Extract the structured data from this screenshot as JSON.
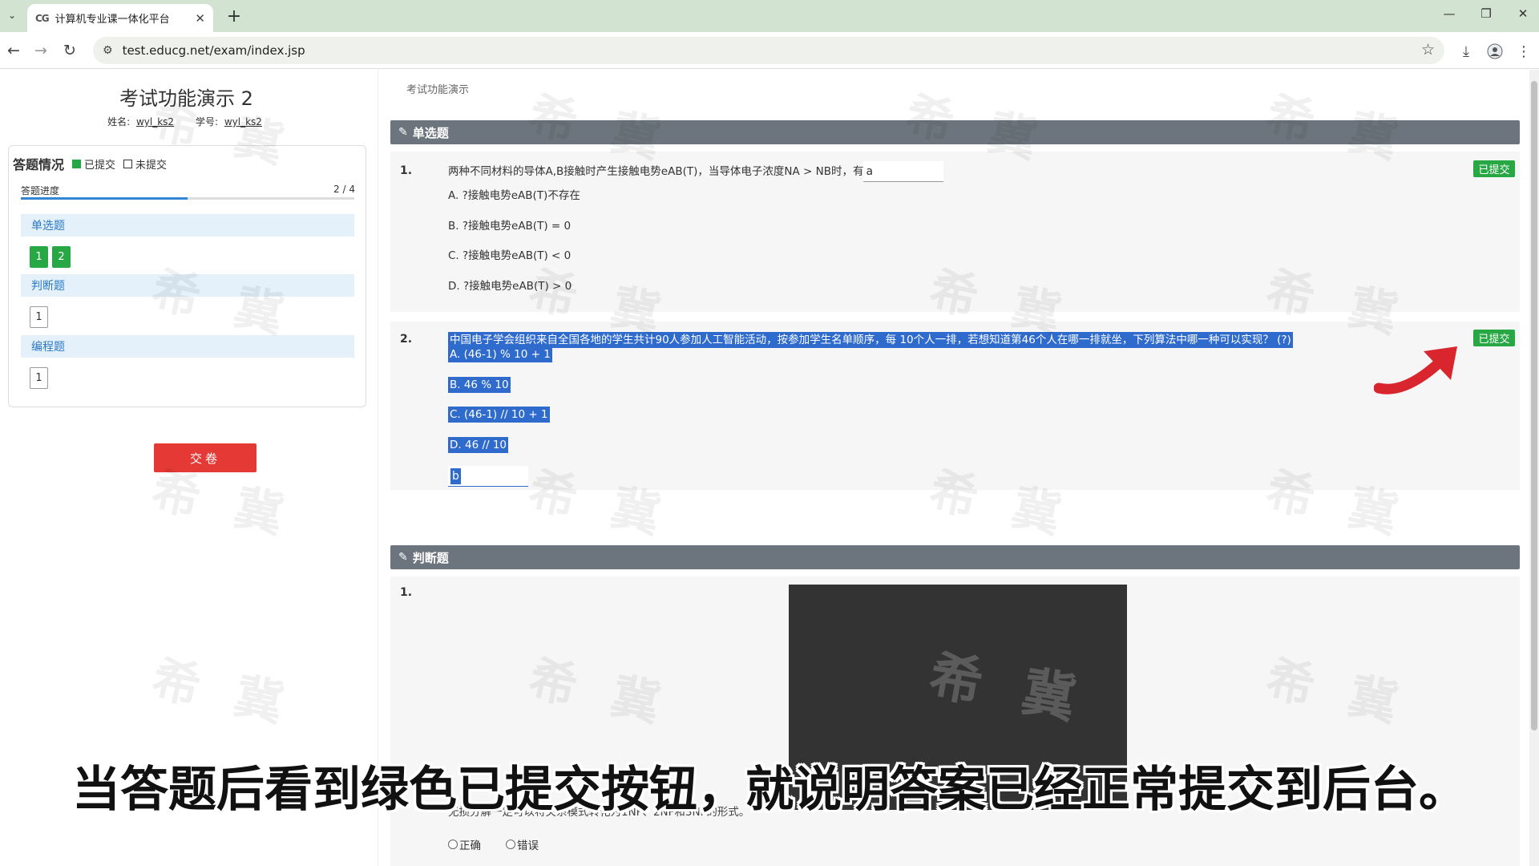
{
  "browser": {
    "tab_favicon": "CG",
    "tab_title": "计算机专业课一体化平台",
    "url": "test.educg.net/exam/index.jsp"
  },
  "sidebar": {
    "exam_title": "考试功能演示 2",
    "name_label": "姓名:",
    "name_value": "wyl_ks2",
    "id_label": "学号:",
    "id_value": "wyl_ks2",
    "status_title": "答题情况",
    "legend_submitted": "已提交",
    "legend_unsubmitted": "未提交",
    "progress_label": "答题进度",
    "progress_count": "2 / 4",
    "progress_fraction": 0.5,
    "sections": [
      {
        "label": "单选题",
        "questions": [
          {
            "num": "1",
            "submitted": true
          },
          {
            "num": "2",
            "submitted": true
          }
        ]
      },
      {
        "label": "判断题",
        "questions": [
          {
            "num": "1",
            "submitted": false
          }
        ]
      },
      {
        "label": "编程题",
        "questions": [
          {
            "num": "1",
            "submitted": false
          }
        ]
      }
    ],
    "submit_label": "交卷"
  },
  "main": {
    "breadcrumb": "考试功能演示",
    "single_choice": {
      "header": "单选题",
      "q1": {
        "num": "1.",
        "text": "两种不同材料的导体A,B接触时产生接触电势eAB(T)，当导体电子浓度NA > NB时，有",
        "answer": "a",
        "options": [
          "A. ?接触电势eAB(T)不存在",
          "B. ?接触电势eAB(T) = 0",
          "C. ?接触电势eAB(T) < 0",
          "D. ?接触电势eAB(T) > 0"
        ],
        "badge": "已提交"
      },
      "q2": {
        "num": "2.",
        "text": "中国电子学会组织来自全国各地的学生共计90人参加人工智能活动，按参加学生名单顺序，每 10个人一排，若想知道第46个人在哪一排就坐，下列算法中哪一种可以实现？ (?)",
        "options": [
          "A.  (46-1) % 10 + 1",
          "B.  46 % 10",
          "C.  (46-1) // 10 + 1",
          "D.  46 // 10"
        ],
        "answer": "b",
        "badge": "已提交"
      }
    },
    "true_false": {
      "header": "判断题",
      "q1": {
        "num": "1.",
        "partial_text": "无损分解一定可以将关系模式转化为1NF、2NF和3NF的形式。",
        "opt_true": "正确",
        "opt_false": "错误"
      }
    },
    "watermark": "希 冀"
  },
  "subtitle": "当答题后看到绿色已提交按钮，就说明答案已经正常提交到后台。",
  "colors": {
    "submitted_green": "#28a745",
    "submit_red": "#e53935",
    "section_gray": "#6c757d",
    "selection_blue": "#2e6bcc",
    "arrow_red": "#d9252d"
  }
}
